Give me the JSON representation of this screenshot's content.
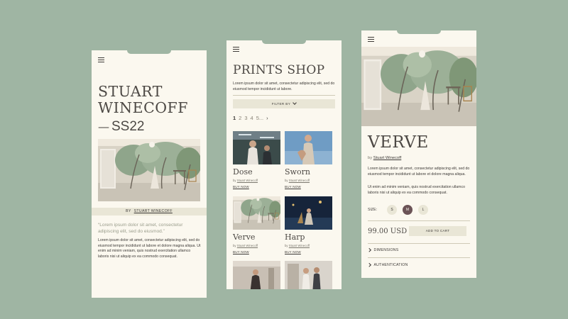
{
  "colors": {
    "background": "#9fb5a3",
    "screen": "#fbf8ef",
    "panel": "#e9e6d6",
    "text": "#3d3a37",
    "selected_size": "#6b5356",
    "quote": "#9a9d8c"
  },
  "icons": {
    "menu": "hamburger-icon",
    "filter": "chevron-down-icon",
    "next_page": "chevron-right-icon",
    "accordion": "chevron-right-icon"
  },
  "home": {
    "title_line1": "STUART",
    "title_line2": "WINECOFF",
    "subtitle_dash": "—",
    "subtitle": "SS22",
    "byline_by": "BY",
    "byline_name": "STUART WINECOFF",
    "quote": "“Lorem ipsum dolor sit amet, consectetur adipiscing elit, sed do eiusmod.”",
    "body": "Lorem ipsum dolor sit amet, consectetur adipiscing elit, sed do eiusmod tempor incididunt ut labore et dolore magna aliqua. Ut enim ad minim veniam, quis nostrud exercitation ullamco laboris nisi ut aliquip ex ea commodo consequat."
  },
  "shop": {
    "title": "PRINTS SHOP",
    "description": "Lorem ipsum dolor sit amet, consectetur adipiscing elit, sed do eiusmod tempor incididunt ut labore.",
    "filter_label": "FILTER BY",
    "pages": [
      "1",
      "2",
      "3",
      "4",
      "5...",
      "›"
    ],
    "products": [
      {
        "name": "Dose",
        "by": "by",
        "artist": "Stuart Winecoff",
        "buy": "BUY NOW"
      },
      {
        "name": "Sworn",
        "by": "by",
        "artist": "Stuart Winecoff",
        "buy": "BUY NOW"
      },
      {
        "name": "Verve",
        "by": "by",
        "artist": "Stuart Winecoff",
        "buy": "BUY NOW"
      },
      {
        "name": "Harp",
        "by": "by",
        "artist": "Stuart Winecoff",
        "buy": "BUY NOW"
      }
    ]
  },
  "product": {
    "title": "VERVE",
    "by": "by",
    "artist": "Stuart Winecoff",
    "body1": "Lorem ipsum dolor sit amet, consectetur adipiscing elit, sed do eiusmod tempor incididunt ut labore et dolore magna aliqua.",
    "body2": "Ut enim ad minim veniam, quis nostrud exercitation ullamco laboris nisi ut aliquip ex ea commodo consequat.",
    "size_label": "SIZE:",
    "sizes": [
      "S",
      "M",
      "L"
    ],
    "selected_size": "M",
    "price": "99.00 USD",
    "add_to_cart": "ADD TO CART",
    "accordion": [
      "DIMENSIONS",
      "AUTHENTICATION"
    ]
  }
}
